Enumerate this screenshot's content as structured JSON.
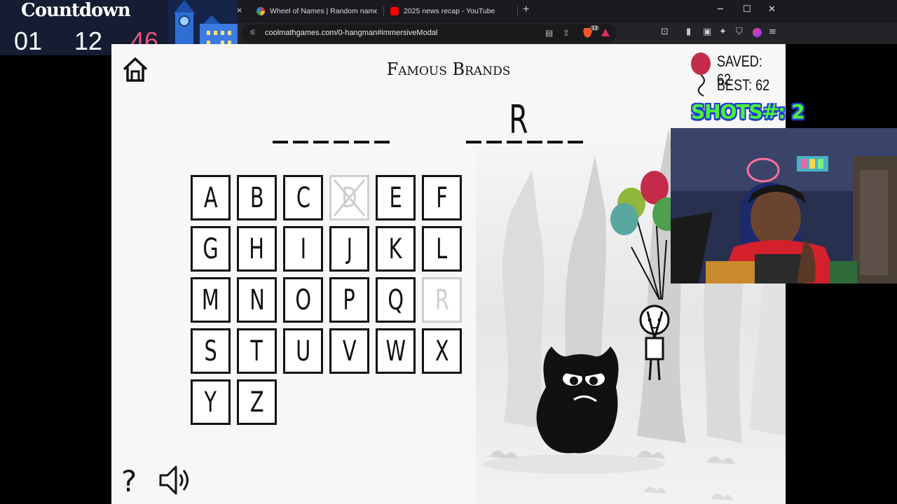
{
  "browser": {
    "tabs": [
      {
        "title": "Wheel of Names | Random name pic",
        "favicon_color": "#4b8cf5"
      },
      {
        "title": "2025 news recap - YouTube",
        "favicon_color": "#ff0000"
      }
    ],
    "close_tab": "×",
    "new_tab": "+",
    "url": "coolmathgames.com/0-hangman#immersiveModal",
    "brave_badge": "12",
    "window_controls": {
      "minimize": "─",
      "maximize": "☐",
      "close": "✕"
    }
  },
  "countdown": {
    "title": "Countdown",
    "hours": "01",
    "minutes": "12",
    "seconds": "46",
    "seconds_color": "#e8547a"
  },
  "game": {
    "category": "Famous Brands",
    "saved_label": "SAVED: 62",
    "best_label": "BEST: 62",
    "word_slots": [
      "",
      "",
      "",
      "",
      "",
      "",
      " ",
      "",
      "",
      "R",
      "",
      "",
      ""
    ],
    "keys": [
      {
        "letter": "A",
        "state": "active"
      },
      {
        "letter": "B",
        "state": "active"
      },
      {
        "letter": "C",
        "state": "active"
      },
      {
        "letter": "D",
        "state": "wrong"
      },
      {
        "letter": "E",
        "state": "active"
      },
      {
        "letter": "F",
        "state": "active"
      },
      {
        "letter": "G",
        "state": "active"
      },
      {
        "letter": "H",
        "state": "active"
      },
      {
        "letter": "I",
        "state": "active"
      },
      {
        "letter": "J",
        "state": "active"
      },
      {
        "letter": "K",
        "state": "active"
      },
      {
        "letter": "L",
        "state": "active"
      },
      {
        "letter": "M",
        "state": "active"
      },
      {
        "letter": "N",
        "state": "active"
      },
      {
        "letter": "O",
        "state": "active"
      },
      {
        "letter": "P",
        "state": "active"
      },
      {
        "letter": "Q",
        "state": "active"
      },
      {
        "letter": "R",
        "state": "correct"
      },
      {
        "letter": "S",
        "state": "active"
      },
      {
        "letter": "T",
        "state": "active"
      },
      {
        "letter": "U",
        "state": "active"
      },
      {
        "letter": "V",
        "state": "active"
      },
      {
        "letter": "W",
        "state": "active"
      },
      {
        "letter": "X",
        "state": "active"
      },
      {
        "letter": "Y",
        "state": "active"
      },
      {
        "letter": "Z",
        "state": "active"
      }
    ],
    "help": "?",
    "balloon_colors": [
      "#5aa7a0",
      "#c42b4a",
      "#8fb83a",
      "#4fa04e",
      "#7a9e9f"
    ]
  },
  "stream": {
    "shots_label": "SHOTS#: 2"
  }
}
